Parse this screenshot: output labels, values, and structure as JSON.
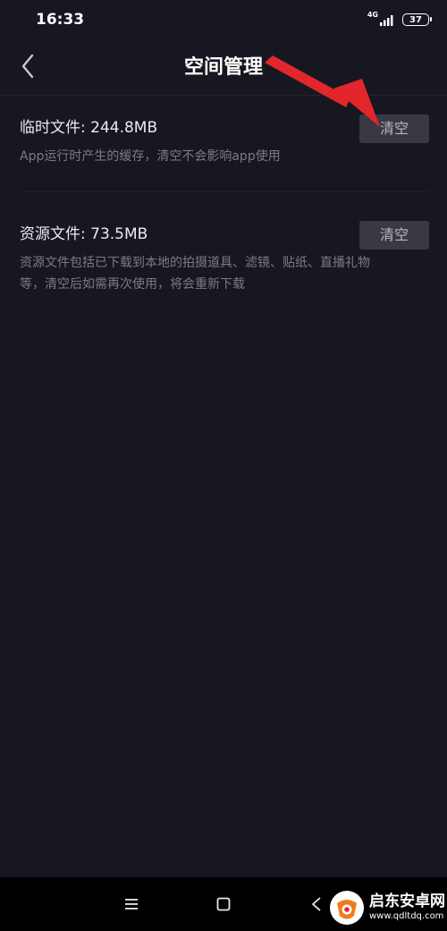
{
  "status_bar": {
    "time": "16:33",
    "network": "4G",
    "battery": "37"
  },
  "header": {
    "title": "空间管理",
    "back_icon": "chevron-left-icon"
  },
  "sections": [
    {
      "title": "临时文件: 244.8MB",
      "description_lines": [
        "App运行时产生的缓存，清空不会影响app使用"
      ],
      "button_label": "清空"
    },
    {
      "title": "资源文件: 73.5MB",
      "description_lines": [
        "资源文件包括已下载到本地的拍摄道具、滤镜、贴纸、直播礼物",
        "等，清空后如需再次使用，将会重新下载"
      ],
      "button_label": "清空"
    }
  ],
  "nav_bar": {
    "icons": [
      "menu-icon",
      "home-square-icon",
      "back-triangle-icon"
    ]
  },
  "watermark": {
    "name": "启东安卓网",
    "url": "www.qdltdq.com"
  },
  "colors": {
    "background": "#171721",
    "button_bg": "#393944",
    "annotation_arrow": "#e3262b"
  }
}
